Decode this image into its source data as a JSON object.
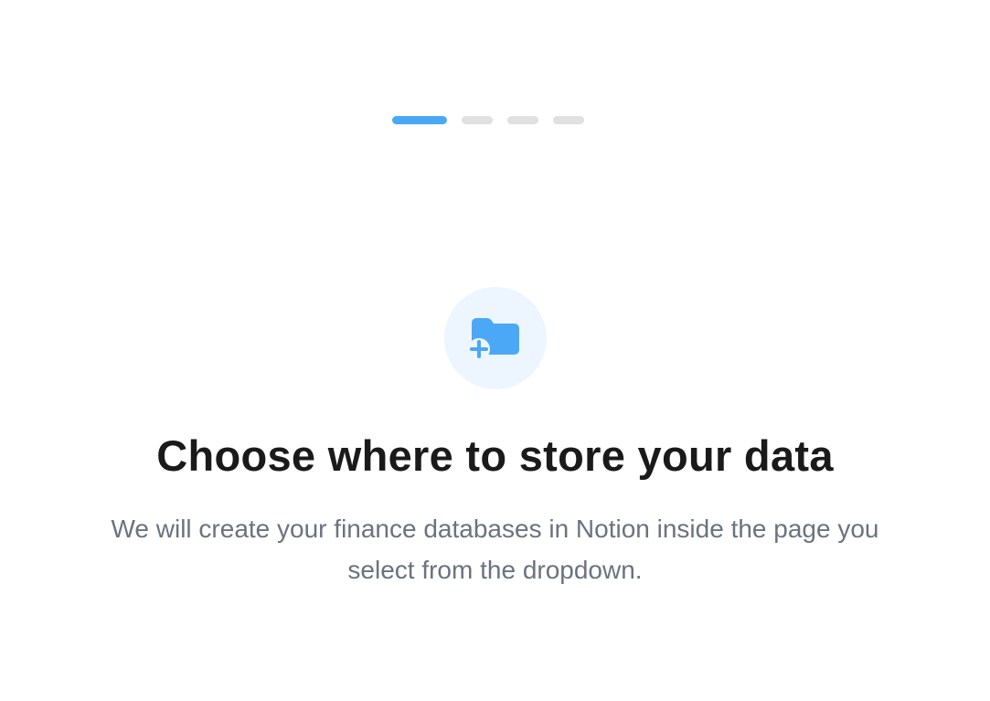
{
  "stepper": {
    "total_steps": 4,
    "current_step": 1,
    "active_color": "#4aa8f7",
    "inactive_color": "#e0e0e0"
  },
  "icon": {
    "name": "folder-plus-icon",
    "color": "#4aa8f7",
    "background": "#edf5fe"
  },
  "heading": {
    "title": "Choose where to store your data",
    "description": "We will create your finance databases in Notion inside the page you select from the dropdown."
  }
}
